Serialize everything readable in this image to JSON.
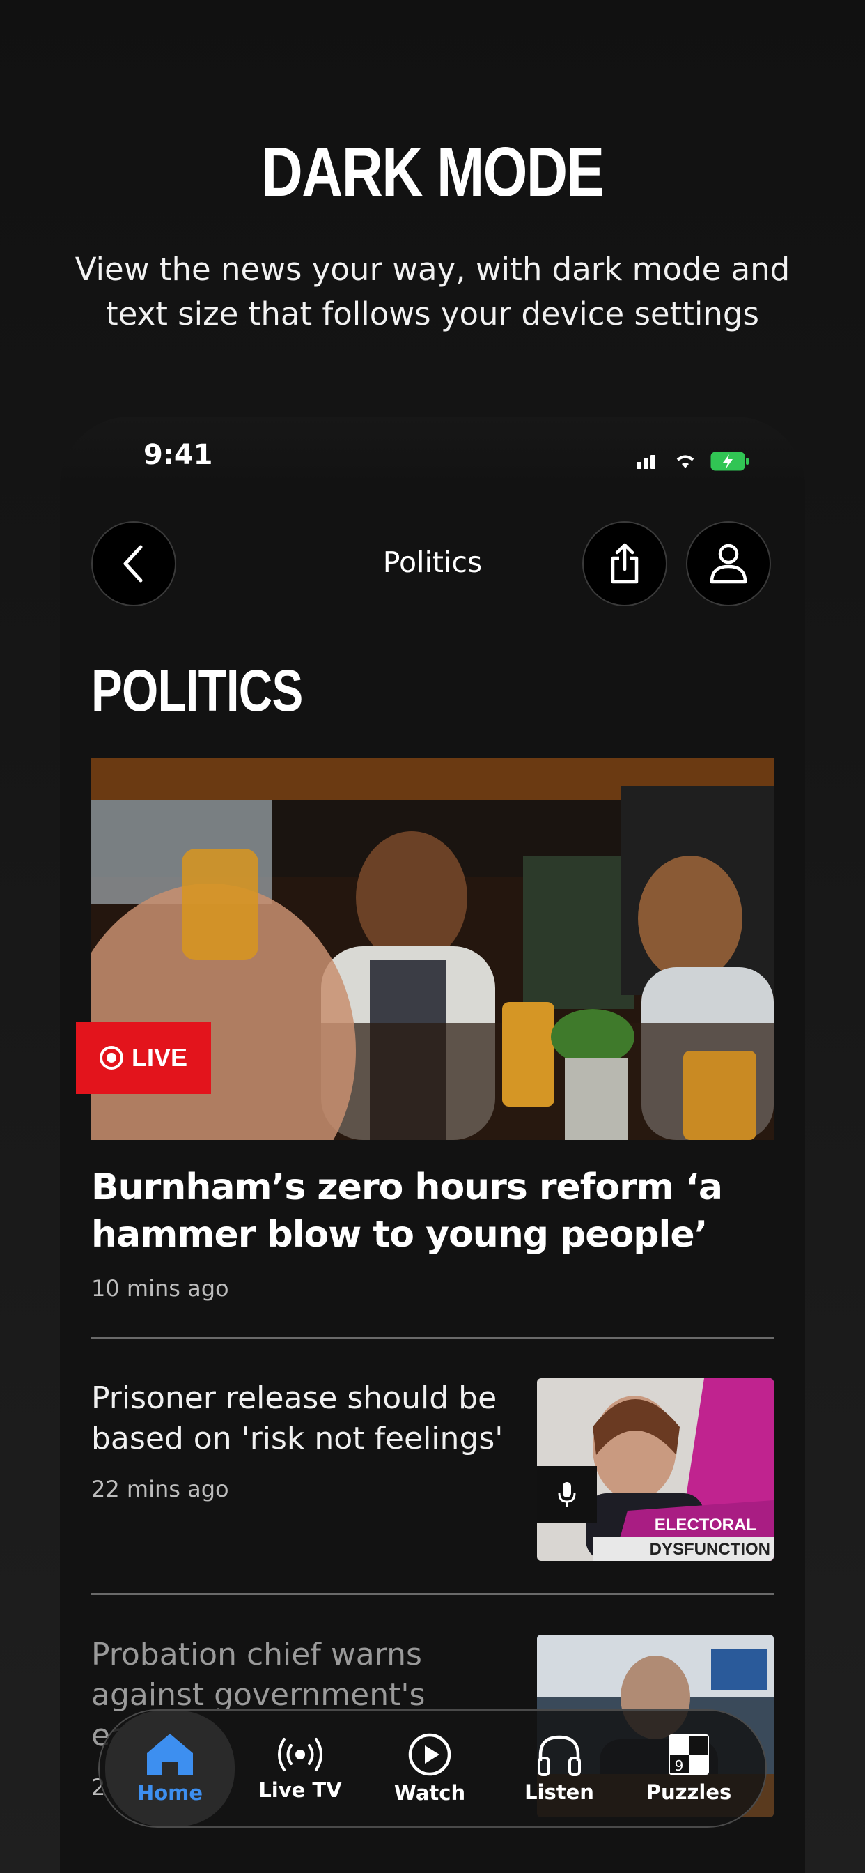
{
  "promo": {
    "title": "DARK MODE",
    "subtitle": "View the news your way, with dark mode and text size that follows your device settings"
  },
  "status_bar": {
    "time": "9:41"
  },
  "nav": {
    "title": "Politics"
  },
  "section": {
    "heading": "POLITICS"
  },
  "hero": {
    "badge": "LIVE",
    "headline": "Burnham’s zero hours reform ‘a hammer blow to young people’",
    "time": "10 mins ago"
  },
  "stories": [
    {
      "title": "Prisoner release should be based on 'risk not feelings'",
      "time": "22 mins ago",
      "thumb_caption_1": "ELECTORAL",
      "thumb_caption_2": "DYSFUNCTION"
    },
    {
      "title": "Probation chief warns against government's early r",
      "time": "2"
    }
  ],
  "tabbar": {
    "items": [
      {
        "label": "Home",
        "icon": "home-icon",
        "active": true
      },
      {
        "label": "Live TV",
        "icon": "broadcast-icon",
        "active": false
      },
      {
        "label": "Watch",
        "icon": "play-icon",
        "active": false
      },
      {
        "label": "Listen",
        "icon": "headphones-icon",
        "active": false
      },
      {
        "label": "Puzzles",
        "icon": "puzzle-grid-icon",
        "active": false
      }
    ]
  },
  "colors": {
    "accent": "#3d8ff0",
    "live_red": "#e3141c",
    "background": "#121212"
  }
}
